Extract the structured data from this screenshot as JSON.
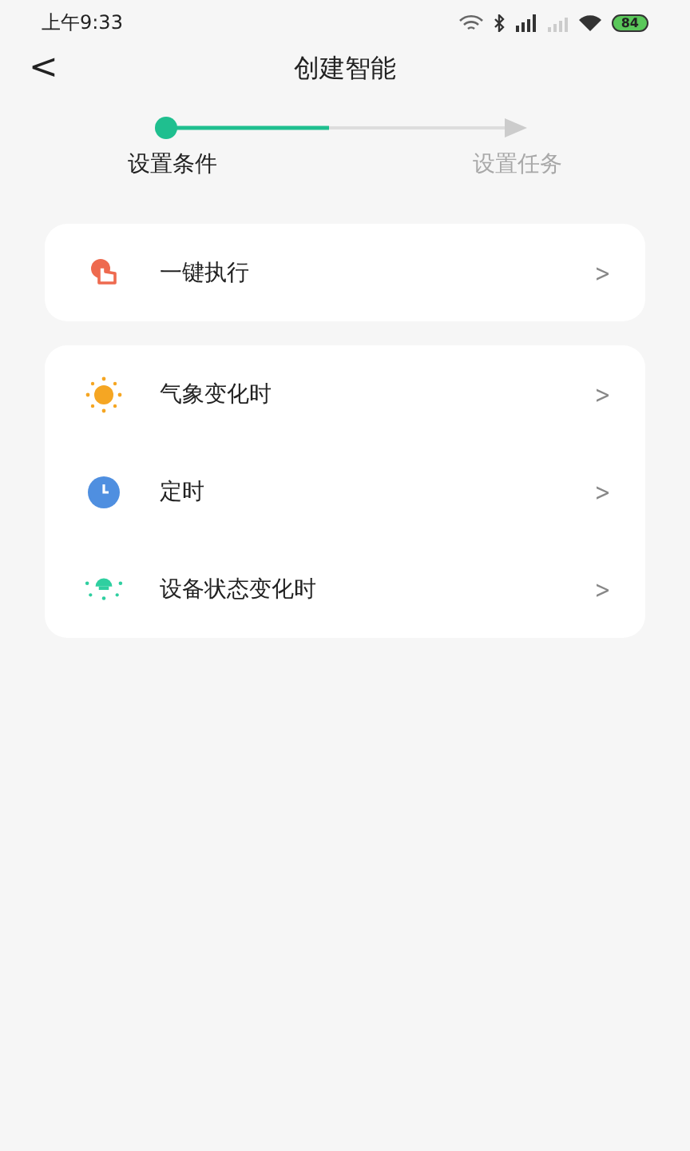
{
  "status_bar": {
    "time": "上午9:33",
    "battery": "84"
  },
  "header": {
    "back": "<",
    "title": "创建智能"
  },
  "steps": [
    {
      "label": "设置条件",
      "selected": true
    },
    {
      "label": "设置任务",
      "selected": false
    }
  ],
  "groups": [
    {
      "items": [
        {
          "kind": "tap",
          "label": "一键执行",
          "chevron": ">"
        }
      ]
    },
    {
      "items": [
        {
          "kind": "sun",
          "label": "气象变化时",
          "chevron": ">"
        },
        {
          "kind": "clock",
          "label": "定时",
          "chevron": ">"
        },
        {
          "kind": "bulb",
          "label": "设备状态变化时",
          "chevron": ">"
        }
      ]
    }
  ]
}
